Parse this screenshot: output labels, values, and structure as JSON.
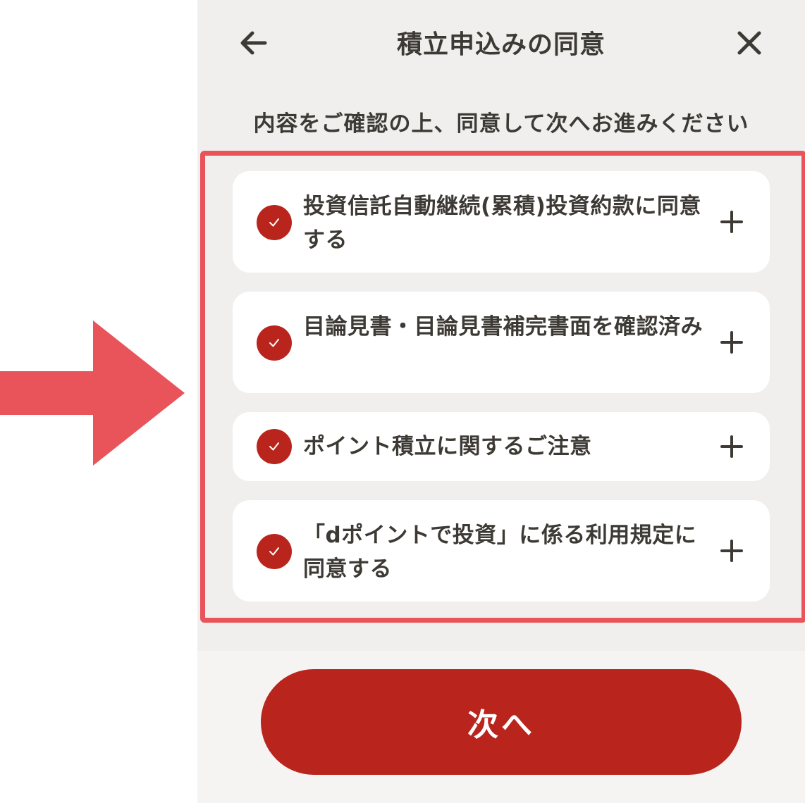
{
  "header": {
    "title": "積立申込みの同意",
    "back_icon": "back-arrow-icon",
    "close_icon": "close-icon"
  },
  "subtitle": "内容をご確認の上、同意して次へお進みください",
  "agreements": [
    {
      "label": "投資信託自動継続(累積)投資約款に同意する",
      "checked": true
    },
    {
      "label": "目論見書・目論見書補完書面を確認済み",
      "checked": true
    },
    {
      "label": "ポイント積立に関するご注意",
      "checked": true
    },
    {
      "label": "「dポイントで投資」に係る利用規定に同意する",
      "checked": true
    }
  ],
  "footer": {
    "next_label": "次へ"
  },
  "colors": {
    "accent": "#b9251d",
    "highlight": "#e8545a",
    "background": "#f0efed",
    "text": "#3d3a35"
  }
}
